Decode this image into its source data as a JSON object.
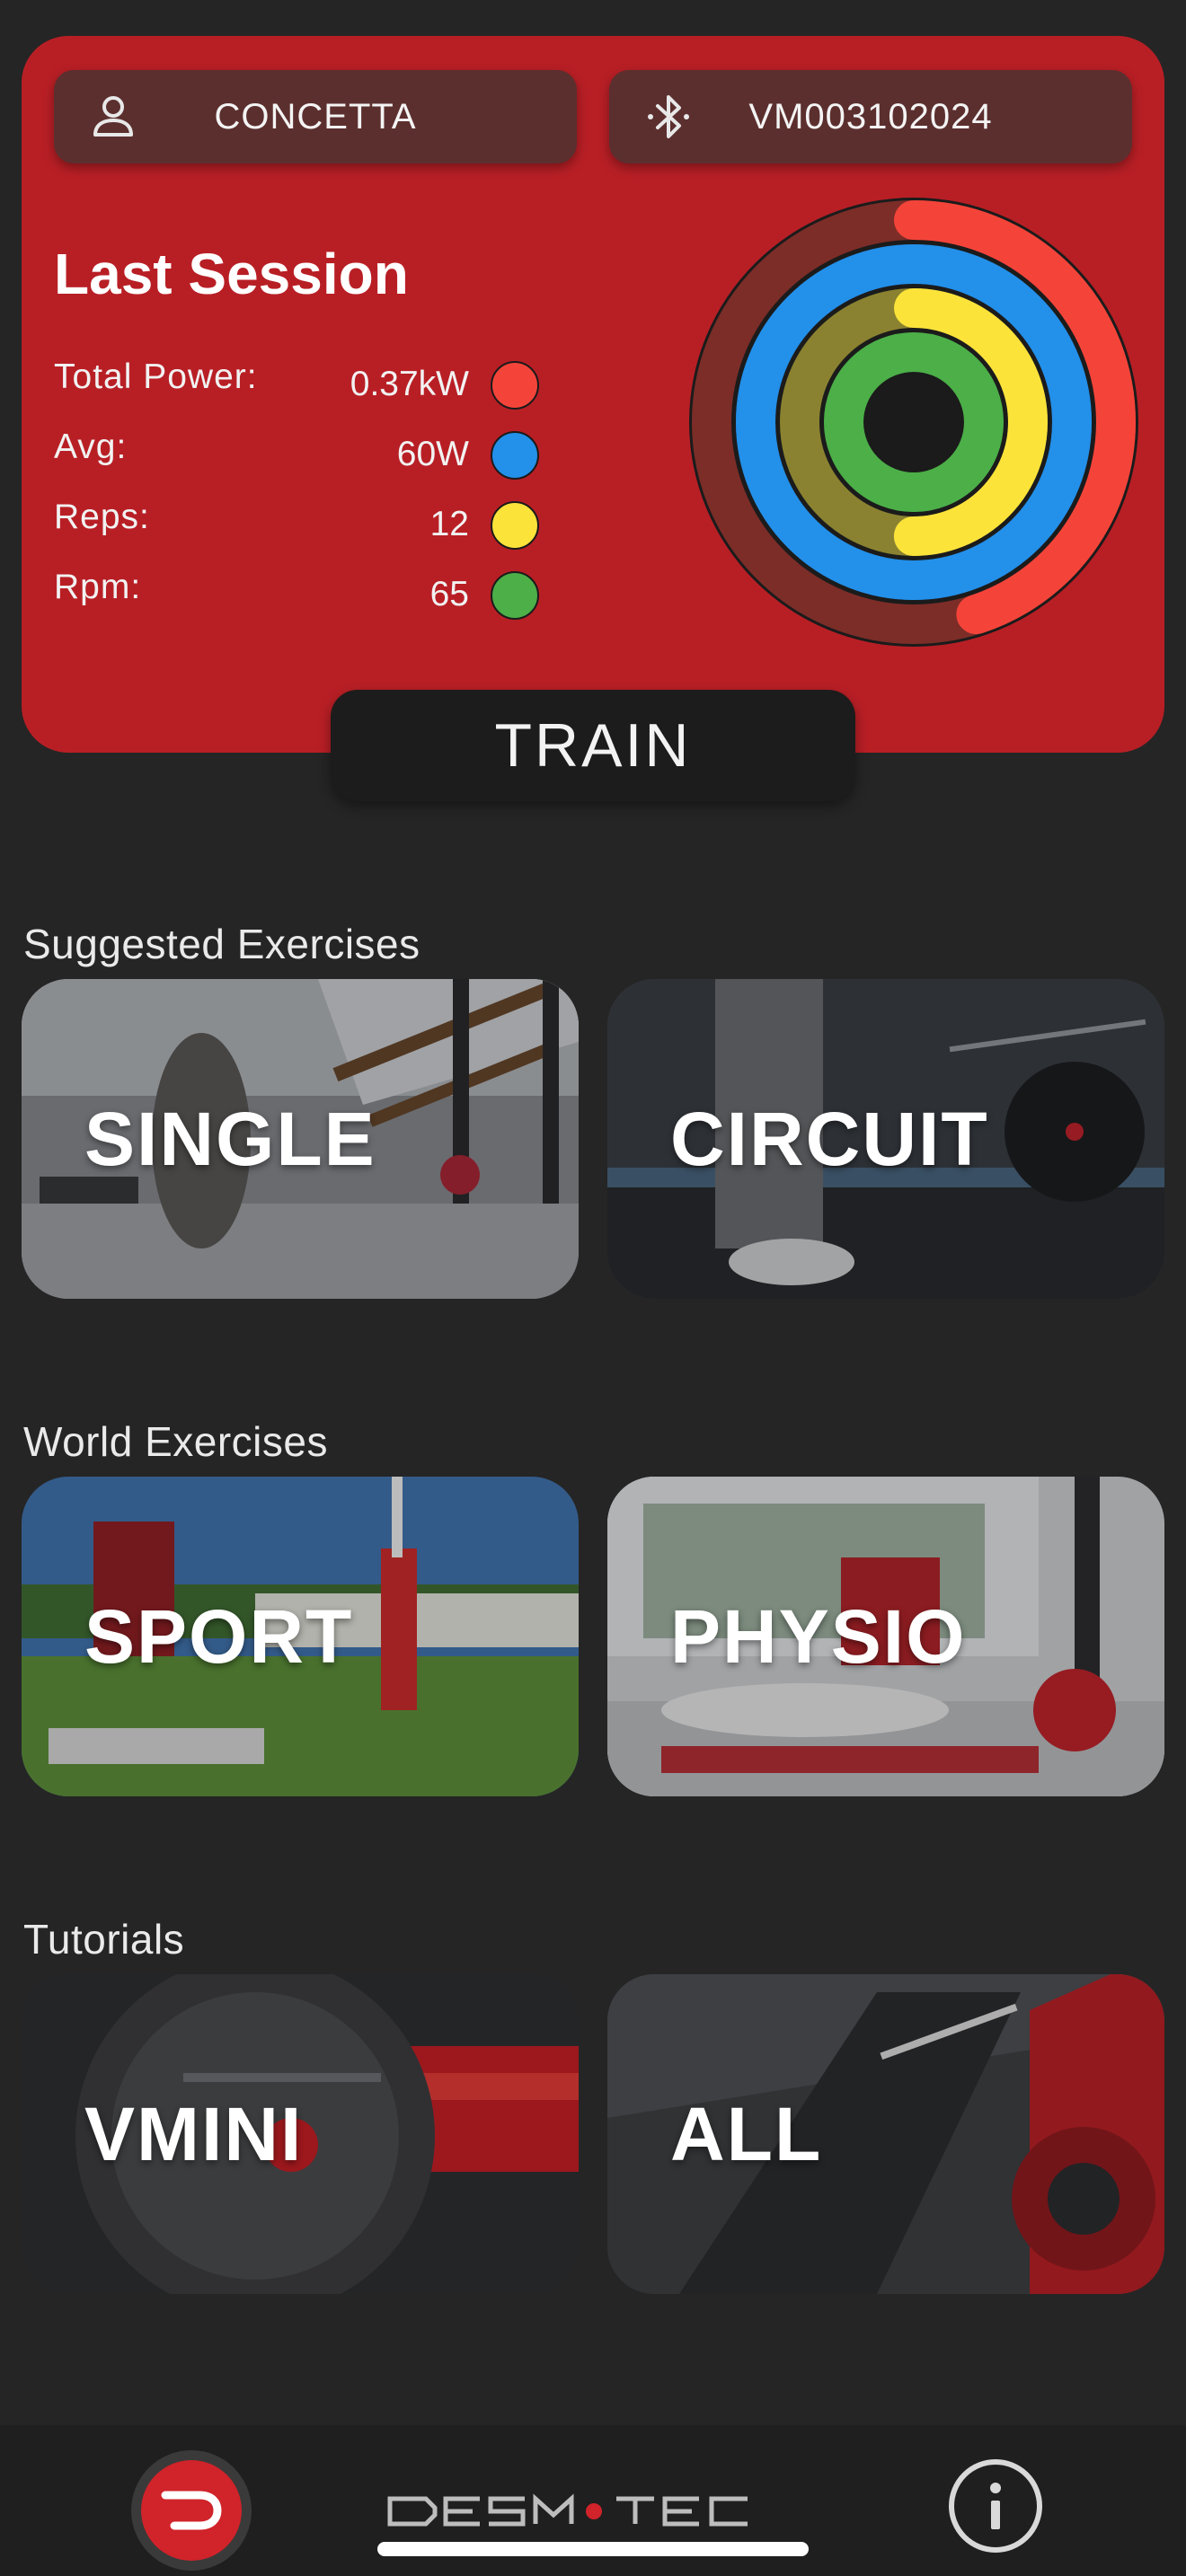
{
  "header": {
    "user_name": "CONCETTA",
    "device_id": "VM003102024",
    "user_icon": "user-icon",
    "device_icon": "bluetooth-icon"
  },
  "last_session": {
    "title": "Last Session",
    "stats": [
      {
        "label": "Total Power:",
        "value": "0.37kW",
        "color": "#f4443a",
        "progress": 0.45
      },
      {
        "label": "Avg:",
        "value": "60W",
        "color": "#2390ea",
        "progress": 1.0
      },
      {
        "label": "Reps:",
        "value": "12",
        "color": "#fbe33a",
        "progress": 0.5
      },
      {
        "label": "Rpm:",
        "value": "65",
        "color": "#4caf48",
        "progress": 1.0
      }
    ]
  },
  "train_button": "TRAIN",
  "sections": [
    {
      "title": "Suggested Exercises",
      "tiles": [
        {
          "label": "SINGLE"
        },
        {
          "label": "CIRCUIT"
        }
      ]
    },
    {
      "title": "World Exercises",
      "tiles": [
        {
          "label": "SPORT"
        },
        {
          "label": "PHYSIO"
        }
      ]
    },
    {
      "title": "Tutorials",
      "tiles": [
        {
          "label": "VMINI"
        },
        {
          "label": "ALL"
        }
      ]
    }
  ],
  "bottom_nav": {
    "home_icon": "desmotec-logo-icon",
    "brand_icon": "desmotec-wordmark",
    "info_icon": "info-icon"
  },
  "colors": {
    "card_red": "#b81f25",
    "background": "#252525",
    "accent": "#d0232a"
  }
}
